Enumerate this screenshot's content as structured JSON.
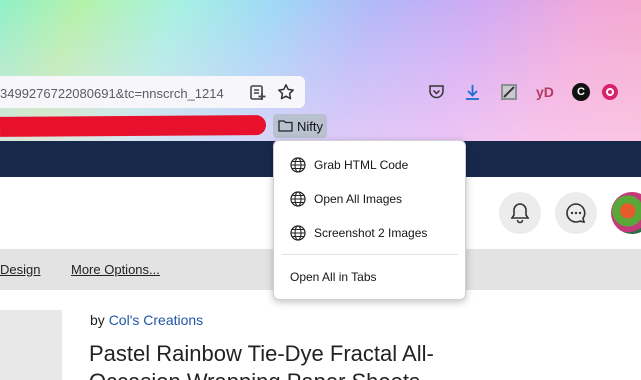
{
  "browser": {
    "url_text": "3499276722080691&tc=nnscrch_1214",
    "bookmark": {
      "label": "Nifty"
    },
    "toolbar_icons": [
      "reader-add-icon",
      "star-icon",
      "pocket-icon",
      "download-icon",
      "screenshot-extension-icon",
      "yd-extension-icon",
      "c-extension-icon",
      "firefox-extension-icon"
    ],
    "yd_label": "yD",
    "c_label": "C"
  },
  "menu": {
    "items": [
      {
        "label": "Grab HTML Code",
        "icon": "globe-icon"
      },
      {
        "label": "Open All Images",
        "icon": "globe-icon"
      },
      {
        "label": "Screenshot 2 Images",
        "icon": "globe-icon"
      }
    ],
    "open_all_label": "Open All in Tabs"
  },
  "page": {
    "nav": {
      "design": "Design",
      "more": "More Options..."
    },
    "by_prefix": "by",
    "by_author": "Col's Creations",
    "title": "Pastel Rainbow Tie-Dye Fractal All-Occasion Wrapping Paper Sheets"
  },
  "colors": {
    "site_bar": "#17294a",
    "link": "#2255a4",
    "scribble": "#e8112d"
  }
}
